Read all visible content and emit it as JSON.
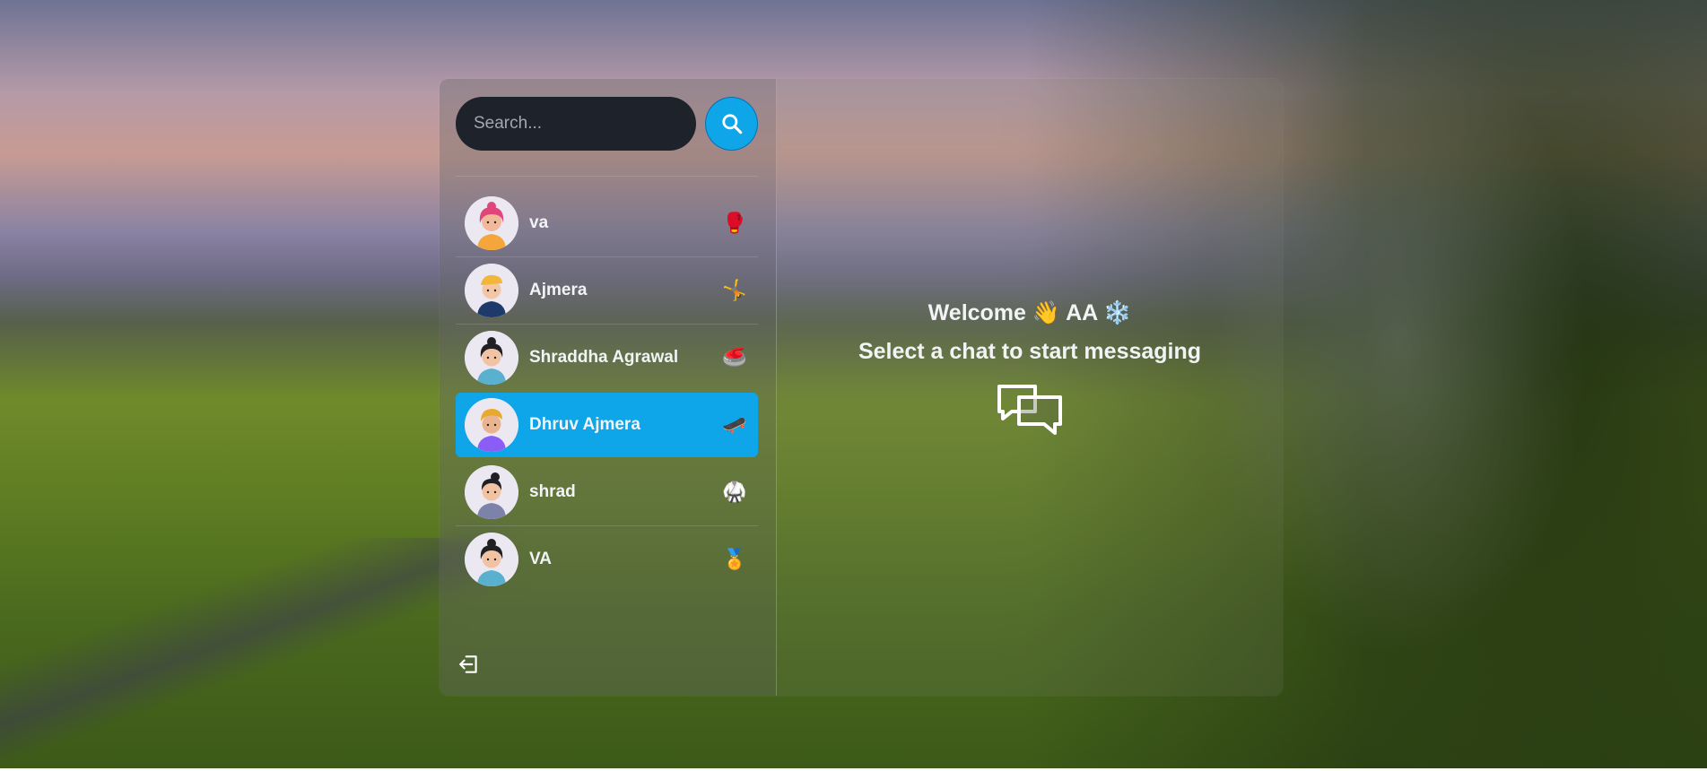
{
  "search": {
    "placeholder": "Search..."
  },
  "chats": [
    {
      "name": "va",
      "emoji": "🥊",
      "selected": false
    },
    {
      "name": "Ajmera",
      "emoji": "🤸",
      "selected": false
    },
    {
      "name": "Shraddha Agrawal",
      "emoji": "🥌",
      "selected": false
    },
    {
      "name": "Dhruv Ajmera",
      "emoji": "🛹",
      "selected": true
    },
    {
      "name": "shrad",
      "emoji": "🥋",
      "selected": false
    },
    {
      "name": "VA",
      "emoji": "🏅",
      "selected": false
    }
  ],
  "welcome": {
    "prefix": "Welcome",
    "wave": "👋",
    "user": "AA",
    "snow": "❄️"
  },
  "subtitle": "Select a chat to start messaging",
  "colors": {
    "accent": "#0ea5e9",
    "input_bg": "#1e232b"
  },
  "icons": {
    "search": "search-icon",
    "logout": "logout-icon",
    "messages": "chat-bubbles-icon"
  }
}
